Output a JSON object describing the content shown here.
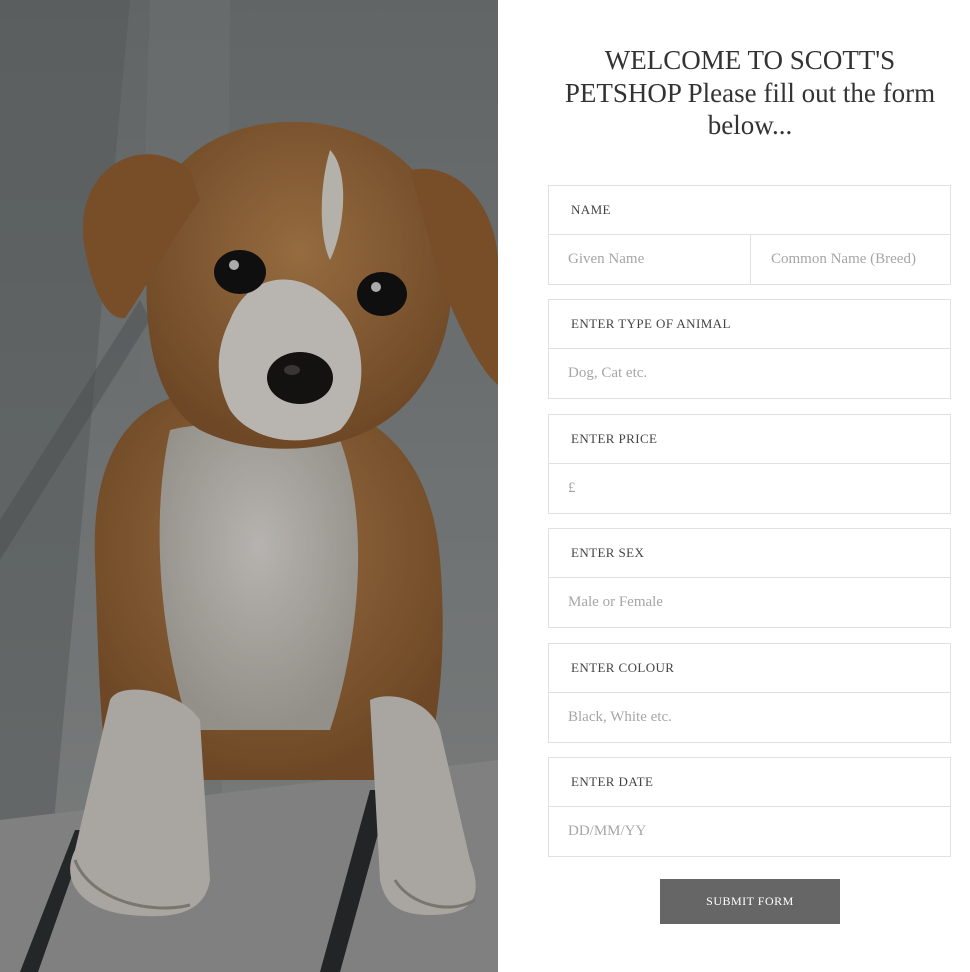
{
  "photo": {
    "alt": "Puppy sitting on wooden deck"
  },
  "heading": "WELCOME TO SCOTT'S PETSHOP Please fill out the form below...",
  "form": {
    "name": {
      "label": "NAME",
      "given_placeholder": "Given Name",
      "common_placeholder": "Common Name (Breed)"
    },
    "animal_type": {
      "label": "ENTER TYPE OF ANIMAL",
      "placeholder": "Dog, Cat etc."
    },
    "price": {
      "label": "ENTER PRICE",
      "placeholder": "£"
    },
    "sex": {
      "label": "ENTER SEX",
      "placeholder": "Male or Female"
    },
    "colour": {
      "label": "ENTER COLOUR",
      "placeholder": "Black, White etc."
    },
    "date": {
      "label": "ENTER DATE",
      "placeholder": "DD/MM/YY"
    },
    "submit_label": "SUBMIT FORM"
  },
  "colors": {
    "button": "#666666",
    "border": "#e1e1e1",
    "heading_text": "#333333",
    "placeholder_text": "#a6a6a6"
  }
}
